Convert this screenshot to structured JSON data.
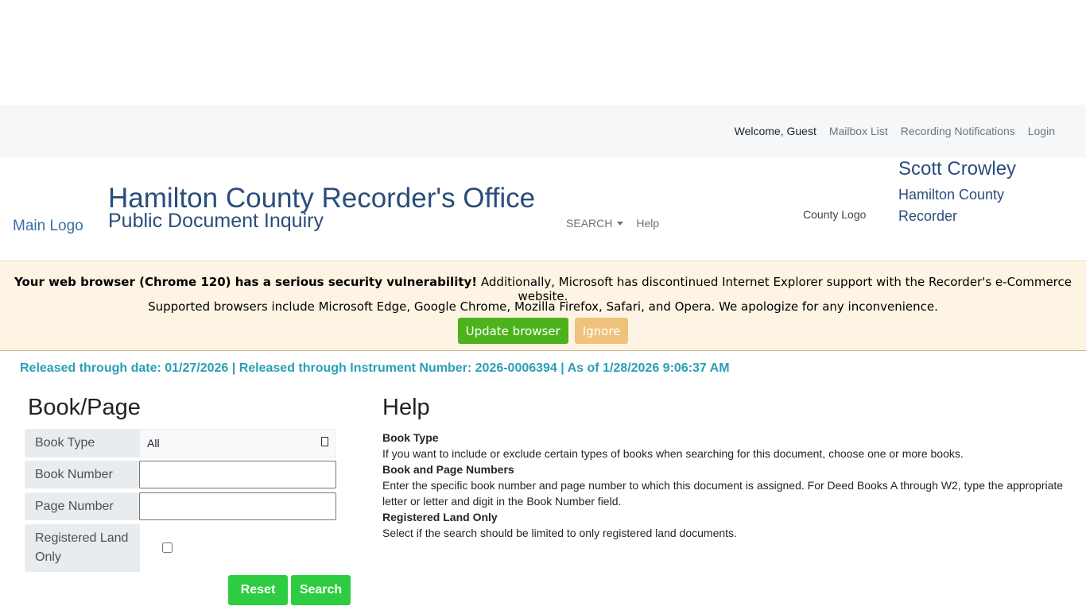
{
  "topbar": {
    "welcome": "Welcome, Guest",
    "links": [
      "Mailbox List",
      "Recording Notifications",
      "Login"
    ]
  },
  "header": {
    "main_logo_alt": "Main Logo",
    "title": "Hamilton County Recorder's Office",
    "subtitle": "Public Document Inquiry",
    "nav_search": "SEARCH",
    "nav_help": "Help",
    "county_logo_alt": "County Logo",
    "recorder_name": "Scott Crowley",
    "recorder_title": "Hamilton County Recorder"
  },
  "warning": {
    "bold": "Your web browser (Chrome 120) has a serious security vulnerability!",
    "rest": " Additionally, Microsoft has discontinued Internet Explorer support with the Recorder's e-Commerce website.",
    "line2": "Supported browsers include Microsoft Edge, Google Chrome, Mozilla Firefox, Safari, and Opera. We apologize for any inconvenience.",
    "update_label": "Update browser",
    "ignore_label": "Ignore"
  },
  "release_info": "Released through date: 01/27/2026 | Released through Instrument Number: 2026-0006394 | As of 1/28/2026 9:06:37 AM",
  "form": {
    "title": "Book/Page",
    "book_type_label": "Book Type",
    "book_type_value": "All",
    "book_number_label": "Book Number",
    "book_number_value": "",
    "page_number_label": "Page Number",
    "page_number_value": "",
    "registered_label": "Registered Land Only",
    "registered_checked": false,
    "reset_label": "Reset",
    "search_label": "Search"
  },
  "help": {
    "title": "Help",
    "items": [
      {
        "heading": "Book Type",
        "text": "If you want to include or exclude certain types of books when searching for this document, choose one or more books."
      },
      {
        "heading": "Book and Page Numbers",
        "text": "Enter the specific book number and page number to which this document is assigned. For Deed Books A through W2, type the appropriate letter or letter and digit in the Book Number field."
      },
      {
        "heading": "Registered Land Only",
        "text": "Select if the search should be limited to only registered land documents."
      }
    ]
  },
  "colors": {
    "title_blue": "#2a4d7a",
    "release_teal": "#2a9fb4",
    "update_green": "#4cb31c",
    "ignore_orange": "#f0c27b",
    "action_green": "#2ecc40"
  }
}
